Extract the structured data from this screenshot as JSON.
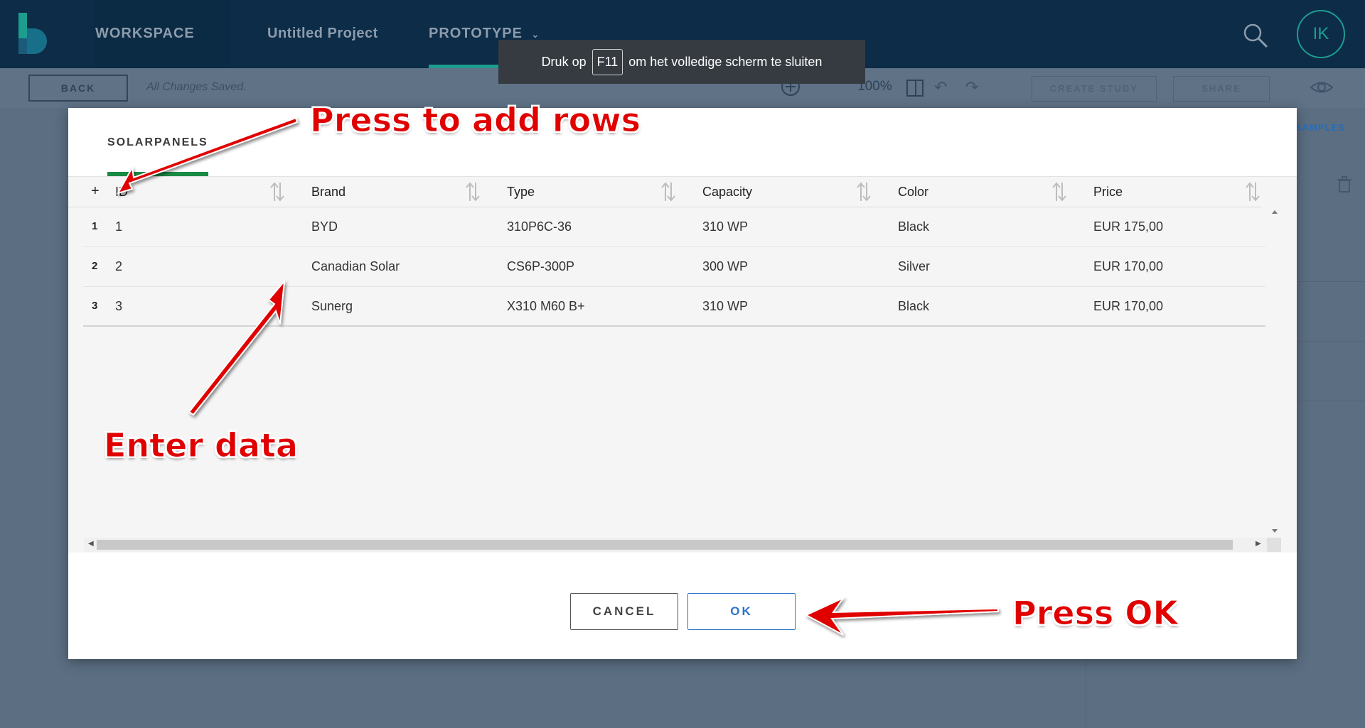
{
  "topbar": {
    "workspace_label": "WORKSPACE",
    "project_label": "Untitled Project",
    "prototype_label": "PROTOTYPE",
    "avatar_initials": "IK"
  },
  "toolbar": {
    "back_label": "BACK",
    "saved_status": "All Changes Saved.",
    "zoom_level": "100%",
    "create_study_label": "CREATE STUDY",
    "share_label": "SHARE"
  },
  "right_panel": {
    "samples_label": "SAMPLES"
  },
  "toast": {
    "prefix": "Druk op",
    "key": "F11",
    "suffix": "om het volledige scherm te sluiten"
  },
  "modal": {
    "tab_label": "SOLARPANELS",
    "add_row_glyph": "+",
    "columns": [
      "ID",
      "Brand",
      "Type",
      "Capacity",
      "Color",
      "Price"
    ],
    "rows": [
      {
        "num": "1",
        "id": "1",
        "brand": "BYD",
        "type": "310P6C-36",
        "capacity": "310 WP",
        "color": "Black",
        "price": "EUR 175,00"
      },
      {
        "num": "2",
        "id": "2",
        "brand": "Canadian Solar",
        "type": "CS6P-300P",
        "capacity": "300 WP",
        "color": "Silver",
        "price": "EUR 170,00"
      },
      {
        "num": "3",
        "id": "3",
        "brand": "Sunerg",
        "type": "X310 M60 B+",
        "capacity": "310 WP",
        "color": "Black",
        "price": "EUR 170,00"
      }
    ],
    "cancel_label": "CANCEL",
    "ok_label": "OK"
  },
  "annotations": {
    "add_rows": "Press to add rows",
    "enter_data": "Enter data",
    "press_ok": "Press OK"
  },
  "colors": {
    "navbar": "#0c2c48",
    "accent_teal": "#1e9d8f",
    "tab_underline_green": "#1a8a45",
    "ok_blue": "#2b74c9",
    "annotation_red": "#e00000"
  }
}
